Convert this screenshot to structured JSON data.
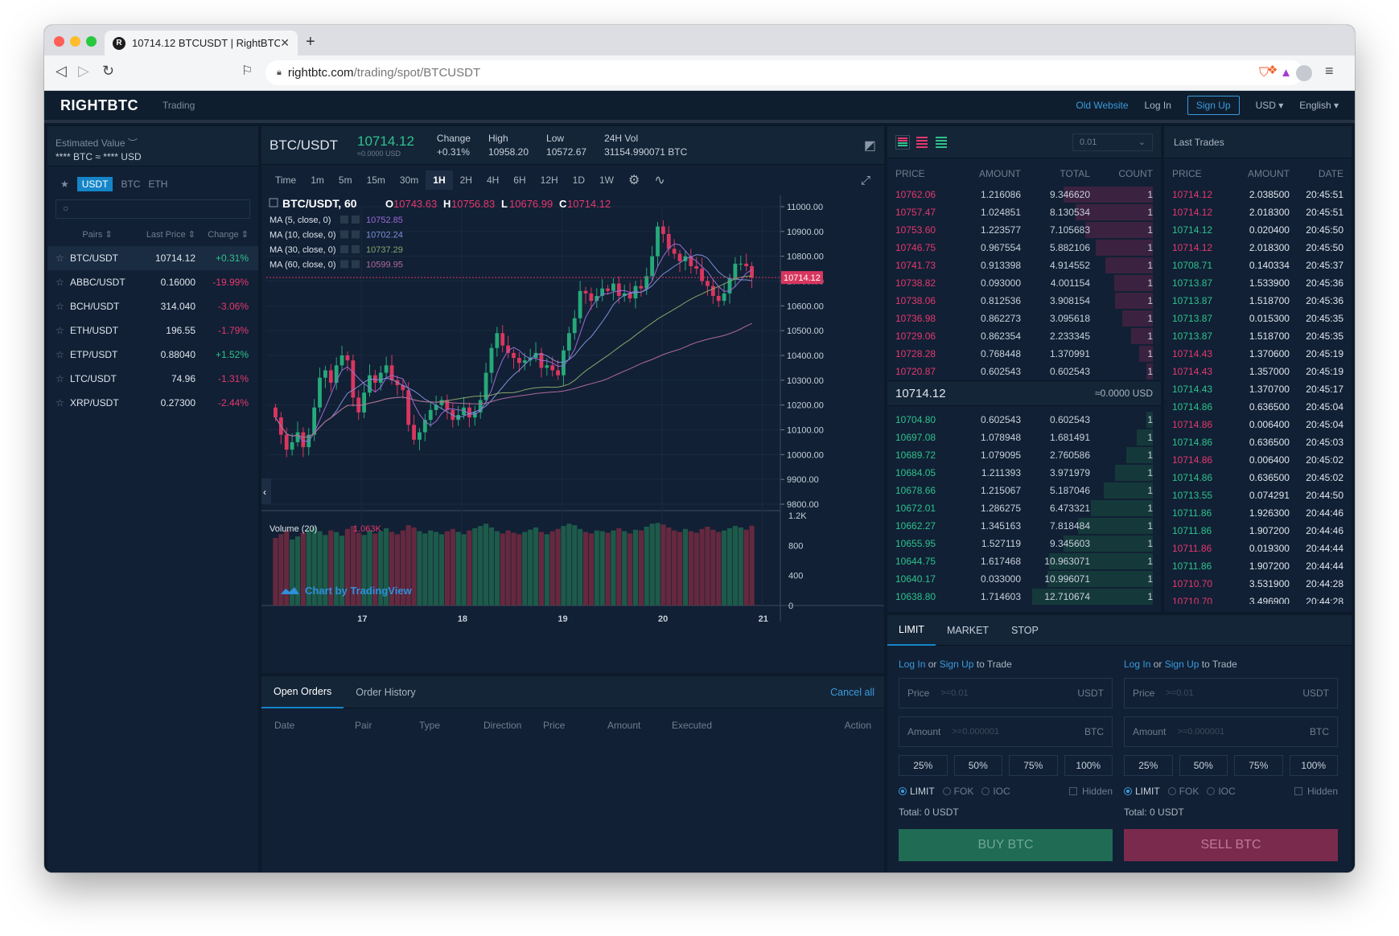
{
  "browser": {
    "tab_title": "10714.12 BTCUSDT | RightBTC",
    "url_host": "rightbtc.com",
    "url_path": "/trading/spot/BTCUSDT"
  },
  "header": {
    "logo": "RIGHTBTC",
    "trading": "Trading",
    "old_website": "Old Website",
    "login": "Log In",
    "signup": "Sign Up",
    "currency": "USD ▾",
    "language": "English ▾"
  },
  "left": {
    "est_label": "Estimated Value",
    "est_value": "**** BTC ≈ **** USD",
    "quote_tabs": [
      "USDT",
      "BTC",
      "ETH"
    ],
    "col_pairs": "Pairs ⇕",
    "col_last": "Last Price ⇕",
    "col_change": "Change ⇕",
    "pairs": [
      {
        "pair": "BTC/USDT",
        "last": "10714.12",
        "change": "+0.31%"
      },
      {
        "pair": "ABBC/USDT",
        "last": "0.16000",
        "change": "-19.99%"
      },
      {
        "pair": "BCH/USDT",
        "last": "314.040",
        "change": "-3.06%"
      },
      {
        "pair": "ETH/USDT",
        "last": "196.55",
        "change": "-1.79%"
      },
      {
        "pair": "ETP/USDT",
        "last": "0.88040",
        "change": "+1.52%"
      },
      {
        "pair": "LTC/USDT",
        "last": "74.96",
        "change": "-1.31%"
      },
      {
        "pair": "XRP/USDT",
        "last": "0.27300",
        "change": "-2.44%"
      }
    ]
  },
  "ticker": {
    "symbol": "BTC/USDT",
    "last": "10714.12",
    "last_usd": "≈0.0000 USD",
    "change_label": "Change",
    "change": "+0.31%",
    "high_label": "High",
    "high": "10958.20",
    "low_label": "Low",
    "low": "10572.67",
    "vol_label": "24H Vol",
    "vol": "31154.990071 BTC"
  },
  "timeframes": [
    "Time",
    "1m",
    "5m",
    "15m",
    "30m",
    "1H",
    "2H",
    "4H",
    "6H",
    "12H",
    "1D",
    "1W"
  ],
  "chart_data": {
    "type": "candlestick",
    "legend_title": "BTC/USDT, 60",
    "ohlc": {
      "o_label": "O",
      "o": "10743.63",
      "h_label": "H",
      "h": "10756.83",
      "l_label": "L",
      "l": "10676.99",
      "c_label": "C",
      "c": "10714.12"
    },
    "ma": [
      {
        "name": "MA (5, close, 0)",
        "value": "10752.85",
        "color": "#9b6bd6"
      },
      {
        "name": "MA (10, close, 0)",
        "value": "10702.24",
        "color": "#7f8fd6"
      },
      {
        "name": "MA (30, close, 0)",
        "value": "10737.29",
        "color": "#86a56a"
      },
      {
        "name": "MA (60, close, 0)",
        "value": "10599.95",
        "color": "#b06a9a"
      }
    ],
    "y_ticks": [
      "11000.00",
      "10900.00",
      "10800.00",
      "10700.00",
      "10600.00",
      "10500.00",
      "10400.00",
      "10300.00",
      "10200.00",
      "10100.00",
      "10000.00",
      "9900.00",
      "9800.00"
    ],
    "ylim": [
      9800,
      11000
    ],
    "last_price": 10714.12,
    "last_price_label": "10714.12",
    "x_ticks": [
      "17",
      "18",
      "19",
      "20",
      "21"
    ],
    "volume_label": "Volume (20)",
    "volume_value": "1.063K",
    "volume_ticks": [
      "1.2K",
      "800",
      "400",
      "0"
    ],
    "volume_max": 1200,
    "watermark": "Chart by TradingView",
    "closes": [
      10150,
      10080,
      10020,
      10050,
      10090,
      10030,
      10080,
      10190,
      10310,
      10340,
      10290,
      10360,
      10400,
      10380,
      10230,
      10170,
      10250,
      10320,
      10290,
      10330,
      10360,
      10300,
      10280,
      10260,
      10120,
      10060,
      10090,
      10140,
      10180,
      10200,
      10220,
      10180,
      10140,
      10160,
      10190,
      10150,
      10170,
      10220,
      10330,
      10430,
      10490,
      10440,
      10410,
      10390,
      10370,
      10380,
      10390,
      10410,
      10350,
      10360,
      10340,
      10320,
      10420,
      10490,
      10550,
      10660,
      10650,
      10620,
      10640,
      10670,
      10660,
      10690,
      10640,
      10650,
      10630,
      10680,
      10670,
      10720,
      10800,
      10920,
      10890,
      10830,
      10810,
      10780,
      10800,
      10760,
      10750,
      10700,
      10680,
      10640,
      10620,
      10650,
      10710,
      10770,
      10770,
      10760,
      10714
    ],
    "volumes": [
      900,
      950,
      1000,
      880,
      920,
      970,
      1010,
      1050,
      990,
      940,
      1000,
      980,
      930,
      1020,
      1060,
      970,
      940,
      1000,
      960,
      990,
      1030,
      980,
      950,
      1000,
      1070,
      1040,
      990,
      960,
      1000,
      980,
      950,
      990,
      1020,
      980,
      950,
      1000,
      1030,
      1060,
      1090,
      1040,
      990,
      960,
      1000,
      970,
      950,
      980,
      1010,
      1040,
      980,
      950,
      990,
      1020,
      1060,
      1090,
      1070,
      1020,
      980,
      960,
      1000,
      990,
      970,
      1000,
      1030,
      990,
      960,
      1010,
      1000,
      1050,
      1090,
      1100,
      1080,
      1040,
      1000,
      980,
      1020,
      990,
      970,
      1020,
      1050,
      1010,
      980,
      1000,
      1030,
      1060,
      1040,
      1010,
      1063
    ],
    "grid": true
  },
  "orders": {
    "tabs": [
      "Open Orders",
      "Order History"
    ],
    "cancel_all": "Cancel all",
    "columns": [
      "Date",
      "Pair",
      "Type",
      "Direction",
      "Price",
      "Amount",
      "Executed",
      "Action"
    ]
  },
  "book": {
    "precision": "0.01",
    "columns": [
      "PRICE",
      "AMOUNT",
      "TOTAL",
      "COUNT"
    ],
    "asks": [
      {
        "price": "10762.06",
        "amount": "1.216086",
        "total": "9.346620",
        "count": "1",
        "depth": 0.74
      },
      {
        "price": "10757.47",
        "amount": "1.024851",
        "total": "8.130534",
        "count": "1",
        "depth": 0.64
      },
      {
        "price": "10753.60",
        "amount": "1.223577",
        "total": "7.105683",
        "count": "1",
        "depth": 0.56
      },
      {
        "price": "10746.75",
        "amount": "0.967554",
        "total": "5.882106",
        "count": "1",
        "depth": 0.47
      },
      {
        "price": "10741.73",
        "amount": "0.913398",
        "total": "4.914552",
        "count": "1",
        "depth": 0.39
      },
      {
        "price": "10738.82",
        "amount": "0.093000",
        "total": "4.001154",
        "count": "1",
        "depth": 0.32
      },
      {
        "price": "10738.06",
        "amount": "0.812536",
        "total": "3.908154",
        "count": "1",
        "depth": 0.31
      },
      {
        "price": "10736.98",
        "amount": "0.862273",
        "total": "3.095618",
        "count": "1",
        "depth": 0.25
      },
      {
        "price": "10729.06",
        "amount": "0.862354",
        "total": "2.233345",
        "count": "1",
        "depth": 0.18
      },
      {
        "price": "10728.28",
        "amount": "0.768448",
        "total": "1.370991",
        "count": "1",
        "depth": 0.11
      },
      {
        "price": "10720.87",
        "amount": "0.602543",
        "total": "0.602543",
        "count": "1",
        "depth": 0.05
      }
    ],
    "mid_price": "10714.12",
    "mid_usd": "≈0.0000 USD",
    "bids": [
      {
        "price": "10704.80",
        "amount": "0.602543",
        "total": "0.602543",
        "count": "1",
        "depth": 0.05
      },
      {
        "price": "10697.08",
        "amount": "1.078948",
        "total": "1.681491",
        "count": "1",
        "depth": 0.13
      },
      {
        "price": "10689.72",
        "amount": "1.079095",
        "total": "2.760586",
        "count": "1",
        "depth": 0.22
      },
      {
        "price": "10684.05",
        "amount": "1.211393",
        "total": "3.971979",
        "count": "1",
        "depth": 0.31
      },
      {
        "price": "10678.66",
        "amount": "1.215067",
        "total": "5.187046",
        "count": "1",
        "depth": 0.41
      },
      {
        "price": "10672.01",
        "amount": "1.286275",
        "total": "6.473321",
        "count": "1",
        "depth": 0.51
      },
      {
        "price": "10662.27",
        "amount": "1.345163",
        "total": "7.818484",
        "count": "1",
        "depth": 0.62
      },
      {
        "price": "10655.95",
        "amount": "1.527119",
        "total": "9.345603",
        "count": "1",
        "depth": 0.74
      },
      {
        "price": "10644.75",
        "amount": "1.617468",
        "total": "10.963071",
        "count": "1",
        "depth": 0.86
      },
      {
        "price": "10640.17",
        "amount": "0.033000",
        "total": "10.996071",
        "count": "1",
        "depth": 0.87
      },
      {
        "price": "10638.80",
        "amount": "1.714603",
        "total": "12.710674",
        "count": "1",
        "depth": 1.0
      }
    ]
  },
  "trades": {
    "title": "Last Trades",
    "columns": [
      "PRICE",
      "AMOUNT",
      "DATE"
    ],
    "rows": [
      {
        "price": "10714.12",
        "amount": "2.038500",
        "time": "20:45:51",
        "side": "sell"
      },
      {
        "price": "10714.12",
        "amount": "2.018300",
        "time": "20:45:51",
        "side": "sell"
      },
      {
        "price": "10714.12",
        "amount": "0.020400",
        "time": "20:45:50",
        "side": "buy"
      },
      {
        "price": "10714.12",
        "amount": "2.018300",
        "time": "20:45:50",
        "side": "sell"
      },
      {
        "price": "10708.71",
        "amount": "0.140334",
        "time": "20:45:37",
        "side": "buy"
      },
      {
        "price": "10713.87",
        "amount": "1.533900",
        "time": "20:45:36",
        "side": "buy"
      },
      {
        "price": "10713.87",
        "amount": "1.518700",
        "time": "20:45:36",
        "side": "buy"
      },
      {
        "price": "10713.87",
        "amount": "0.015300",
        "time": "20:45:35",
        "side": "buy"
      },
      {
        "price": "10713.87",
        "amount": "1.518700",
        "time": "20:45:35",
        "side": "buy"
      },
      {
        "price": "10714.43",
        "amount": "1.370600",
        "time": "20:45:19",
        "side": "sell"
      },
      {
        "price": "10714.43",
        "amount": "1.357000",
        "time": "20:45:19",
        "side": "sell"
      },
      {
        "price": "10714.43",
        "amount": "1.370700",
        "time": "20:45:17",
        "side": "buy"
      },
      {
        "price": "10714.86",
        "amount": "0.636500",
        "time": "20:45:04",
        "side": "buy"
      },
      {
        "price": "10714.86",
        "amount": "0.006400",
        "time": "20:45:04",
        "side": "sell"
      },
      {
        "price": "10714.86",
        "amount": "0.636500",
        "time": "20:45:03",
        "side": "buy"
      },
      {
        "price": "10714.86",
        "amount": "0.006400",
        "time": "20:45:02",
        "side": "sell"
      },
      {
        "price": "10714.86",
        "amount": "0.636500",
        "time": "20:45:02",
        "side": "buy"
      },
      {
        "price": "10713.55",
        "amount": "0.074291",
        "time": "20:44:50",
        "side": "buy"
      },
      {
        "price": "10711.86",
        "amount": "1.926300",
        "time": "20:44:46",
        "side": "buy"
      },
      {
        "price": "10711.86",
        "amount": "1.907200",
        "time": "20:44:46",
        "side": "buy"
      },
      {
        "price": "10711.86",
        "amount": "0.019300",
        "time": "20:44:44",
        "side": "sell"
      },
      {
        "price": "10711.86",
        "amount": "1.907200",
        "time": "20:44:44",
        "side": "buy"
      },
      {
        "price": "10710.70",
        "amount": "3.531900",
        "time": "20:44:28",
        "side": "sell"
      },
      {
        "price": "10710.70",
        "amount": "3.496900",
        "time": "20:44:28",
        "side": "sell"
      }
    ]
  },
  "form": {
    "tabs": [
      "LIMIT",
      "MARKET",
      "STOP"
    ],
    "login": "Log In",
    "or": " or ",
    "signup": "Sign Up",
    "to_trade": " to Trade",
    "price_label": "Price",
    "price_ph": ">=0.01",
    "price_unit": "USDT",
    "amount_label": "Amount",
    "amount_ph": ">=0.000001",
    "amount_unit": "BTC",
    "pcts": [
      "25%",
      "50%",
      "75%",
      "100%"
    ],
    "types": [
      "LIMIT",
      "FOK",
      "IOC"
    ],
    "hidden": "Hidden",
    "total": "Total:  0 USDT",
    "buy": "BUY BTC",
    "sell": "SELL BTC",
    "buy_color": "#1f6b54",
    "sell_color": "#7a2a4c"
  }
}
